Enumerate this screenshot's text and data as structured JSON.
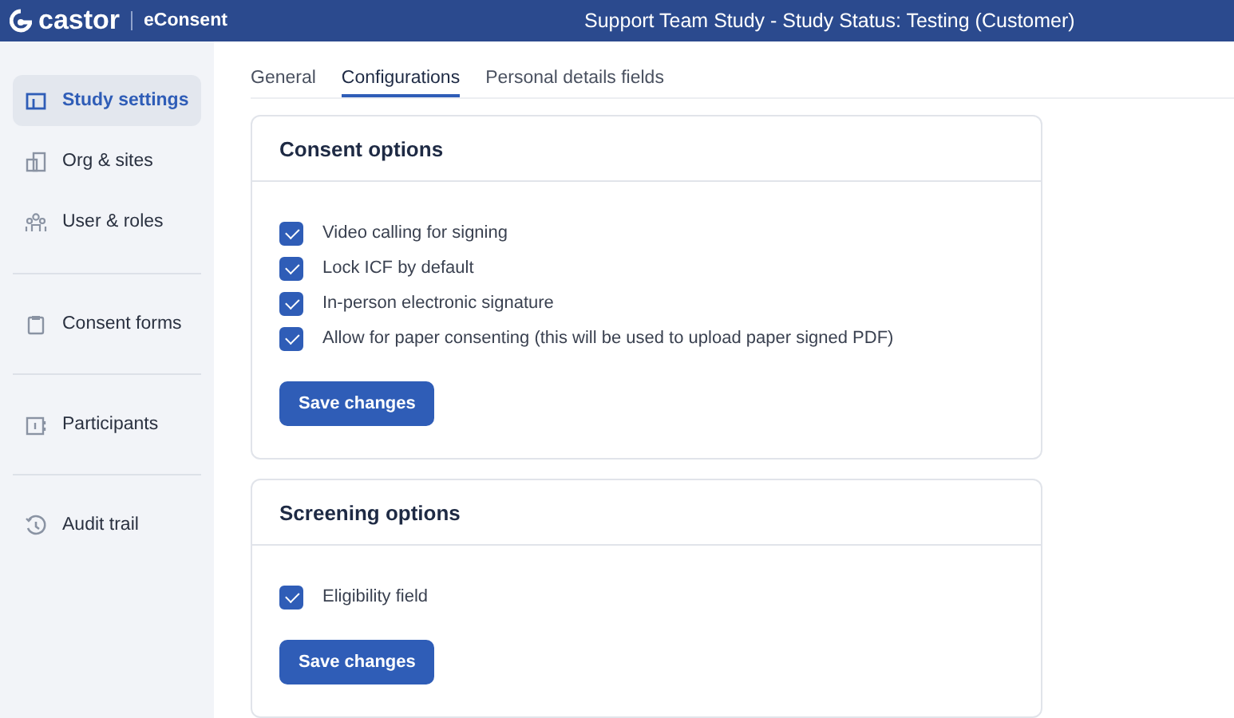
{
  "header": {
    "logo": "castor",
    "product": "eConsent",
    "title": "Support Team Study  - Study Status: Testing (Customer)"
  },
  "sidebar": {
    "groups": [
      [
        {
          "label": "Study settings",
          "selected": true
        },
        {
          "label": "Org & sites",
          "selected": false
        },
        {
          "label": "User & roles",
          "selected": false
        }
      ],
      [
        {
          "label": "Consent forms",
          "selected": false
        }
      ],
      [
        {
          "label": "Participants",
          "selected": false
        }
      ],
      [
        {
          "label": "Audit trail",
          "selected": false
        }
      ]
    ]
  },
  "tabs": [
    {
      "label": "General",
      "selected": false
    },
    {
      "label": "Configurations",
      "selected": true
    },
    {
      "label": "Personal details fields",
      "selected": false
    }
  ],
  "cards": [
    {
      "title": "Consent options",
      "options": [
        {
          "label": "Video calling for signing",
          "checked": true
        },
        {
          "label": "Lock ICF by default",
          "checked": true
        },
        {
          "label": "In-person electronic signature",
          "checked": true
        },
        {
          "label": "Allow for paper consenting (this will be used to upload paper signed PDF)",
          "checked": true
        }
      ],
      "button": "Save changes"
    },
    {
      "title": "Screening options",
      "options": [
        {
          "label": "Eligibility field",
          "checked": true
        }
      ],
      "button": "Save changes"
    }
  ]
}
